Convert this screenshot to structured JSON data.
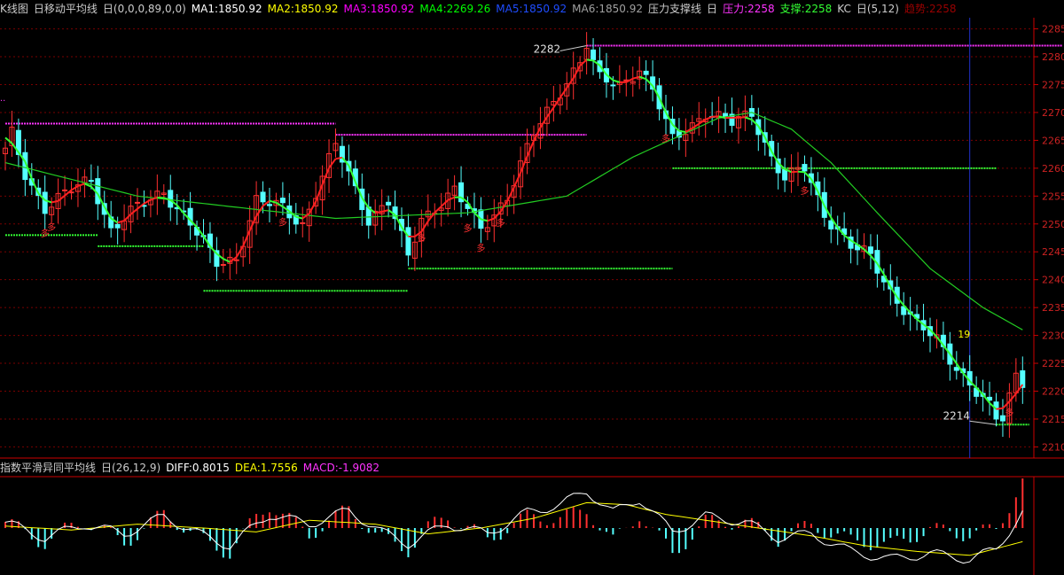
{
  "main_legend": [
    {
      "text": "K线图",
      "color": "#cccccc"
    },
    {
      "text": "日移动平均线",
      "color": "#cccccc"
    },
    {
      "text": "日(0,0,0,89,0,0)",
      "color": "#cccccc"
    },
    {
      "text": "MA1:1850.92",
      "color": "#ffffff"
    },
    {
      "text": "MA2:1850.92",
      "color": "#ffff00"
    },
    {
      "text": "MA3:1850.92",
      "color": "#ff00ff"
    },
    {
      "text": "MA4:2269.26",
      "color": "#00ff00"
    },
    {
      "text": "MA5:1850.92",
      "color": "#1f4dff"
    },
    {
      "text": "MA6:1850.92",
      "color": "#a0a0a0"
    },
    {
      "text": "压力支撑线",
      "color": "#cccccc"
    },
    {
      "text": "日",
      "color": "#cccccc"
    },
    {
      "text": "压力:2258",
      "color": "#ff33ff"
    },
    {
      "text": "支撑:2258",
      "color": "#33ff33"
    },
    {
      "text": "KC",
      "color": "#cccccc"
    },
    {
      "text": "日(5,12)",
      "color": "#cccccc"
    },
    {
      "text": "趋势:2258",
      "color": "#990000"
    }
  ],
  "macd_legend": [
    {
      "text": "指数平滑异同平均线",
      "color": "#cccccc"
    },
    {
      "text": "日(26,12,9)",
      "color": "#cccccc"
    },
    {
      "text": "DIFF:0.8015",
      "color": "#ffffff"
    },
    {
      "text": "DEA:1.7556",
      "color": "#ffff00"
    },
    {
      "text": "MACD:-1.9082",
      "color": "#ff33ff"
    }
  ],
  "colors": {
    "background": "#000000",
    "up": "#ff3030",
    "down": "#54ffff",
    "grid": "#7a0000",
    "axis": "#cc0000",
    "axis_text": "#cc2222",
    "resistance": "#ff33ff",
    "support": "#33ff33",
    "ma_long": "#22cc22",
    "trend_up": "#ff2020",
    "trend_down": "#33ff33",
    "cursor": "#2233cc",
    "diff": "#ffffff",
    "dea": "#ffff00"
  },
  "chart_data": {
    "type": "candlestick",
    "price_axis": {
      "ylim": [
        2208,
        2287
      ],
      "ticks": [
        2210,
        2215,
        2220,
        2225,
        2230,
        2235,
        2240,
        2245,
        2250,
        2255,
        2260,
        2265,
        2270,
        2275,
        2280,
        2285
      ]
    },
    "annotations": [
      {
        "text": "2282",
        "index": 88,
        "price": 2282
      },
      {
        "text": "2214",
        "index": 150,
        "price": 2214
      },
      {
        "text": "19",
        "index": 145,
        "price": 2229
      }
    ],
    "signal_label": "多",
    "cursor_index": 146,
    "resistance_lines": [
      {
        "start": 0,
        "end": 50,
        "price": 2268
      },
      {
        "start": 50,
        "end": 88,
        "price": 2266
      },
      {
        "start": 88,
        "end": 160,
        "price": 2282
      }
    ],
    "support_lines": [
      {
        "start": 0,
        "end": 14,
        "price": 2248
      },
      {
        "start": 14,
        "end": 30,
        "price": 2246
      },
      {
        "start": 30,
        "end": 61,
        "price": 2238
      },
      {
        "start": 61,
        "end": 101,
        "price": 2242
      },
      {
        "start": 101,
        "end": 150,
        "price": 2260
      },
      {
        "start": 150,
        "end": 155,
        "price": 2214
      }
    ],
    "price_anchors": [
      [
        0,
        2263
      ],
      [
        1,
        2266
      ],
      [
        3,
        2259
      ],
      [
        6,
        2253
      ],
      [
        10,
        2256
      ],
      [
        13,
        2258
      ],
      [
        16,
        2249
      ],
      [
        19,
        2252
      ],
      [
        24,
        2256
      ],
      [
        28,
        2250
      ],
      [
        32,
        2243
      ],
      [
        35,
        2244
      ],
      [
        38,
        2254
      ],
      [
        42,
        2253
      ],
      [
        45,
        2250
      ],
      [
        50,
        2264
      ],
      [
        52,
        2259
      ],
      [
        55,
        2251
      ],
      [
        58,
        2254
      ],
      [
        61,
        2244
      ],
      [
        63,
        2251
      ],
      [
        68,
        2256
      ],
      [
        72,
        2249
      ],
      [
        76,
        2255
      ],
      [
        80,
        2266
      ],
      [
        84,
        2274
      ],
      [
        88,
        2281
      ],
      [
        90,
        2276
      ],
      [
        93,
        2275
      ],
      [
        96,
        2278
      ],
      [
        98,
        2274
      ],
      [
        101,
        2265
      ],
      [
        103,
        2267
      ],
      [
        106,
        2270
      ],
      [
        110,
        2268
      ],
      [
        113,
        2270
      ],
      [
        116,
        2262
      ],
      [
        118,
        2258
      ],
      [
        121,
        2260
      ],
      [
        124,
        2252
      ],
      [
        128,
        2246
      ],
      [
        131,
        2244
      ],
      [
        134,
        2238
      ],
      [
        138,
        2232
      ],
      [
        141,
        2229
      ],
      [
        145,
        2223
      ],
      [
        149,
        2217
      ],
      [
        151,
        2215
      ],
      [
        153,
        2223
      ],
      [
        154,
        2222
      ]
    ],
    "ma_long_anchors": [
      [
        0,
        2261
      ],
      [
        20,
        2255
      ],
      [
        50,
        2251
      ],
      [
        70,
        2252
      ],
      [
        85,
        2255
      ],
      [
        95,
        2262
      ],
      [
        108,
        2269
      ],
      [
        113,
        2270
      ],
      [
        119,
        2267
      ],
      [
        125,
        2261
      ],
      [
        132,
        2252
      ],
      [
        140,
        2242
      ],
      [
        148,
        2235
      ],
      [
        154,
        2231
      ]
    ],
    "macd": {
      "diff_anchors": [
        [
          0,
          0.3
        ],
        [
          6,
          -0.5
        ],
        [
          12,
          0.2
        ],
        [
          18,
          -0.3
        ],
        [
          24,
          0.6
        ],
        [
          30,
          -0.4
        ],
        [
          34,
          -0.9
        ],
        [
          40,
          0.7
        ],
        [
          46,
          0.2
        ],
        [
          52,
          0.9
        ],
        [
          57,
          -0.2
        ],
        [
          61,
          -0.8
        ],
        [
          67,
          0.2
        ],
        [
          73,
          -0.3
        ],
        [
          79,
          0.8
        ],
        [
          84,
          1.2
        ],
        [
          88,
          1.9
        ],
        [
          92,
          0.8
        ],
        [
          96,
          1.5
        ],
        [
          101,
          -0.2
        ],
        [
          106,
          0.6
        ],
        [
          112,
          0.3
        ],
        [
          117,
          -0.5
        ],
        [
          122,
          -0.3
        ],
        [
          128,
          -1.2
        ],
        [
          134,
          -1.6
        ],
        [
          140,
          -1.3
        ],
        [
          146,
          -1.6
        ],
        [
          150,
          -1.1
        ],
        [
          154,
          0.8
        ]
      ],
      "dea_anchors": [
        [
          0,
          0.1
        ],
        [
          10,
          -0.1
        ],
        [
          20,
          0.2
        ],
        [
          30,
          0.0
        ],
        [
          38,
          -0.2
        ],
        [
          46,
          0.4
        ],
        [
          56,
          0.2
        ],
        [
          64,
          -0.3
        ],
        [
          72,
          0.0
        ],
        [
          80,
          0.5
        ],
        [
          88,
          1.3
        ],
        [
          94,
          1.2
        ],
        [
          100,
          0.7
        ],
        [
          106,
          0.4
        ],
        [
          114,
          0.0
        ],
        [
          122,
          -0.4
        ],
        [
          130,
          -0.9
        ],
        [
          138,
          -1.2
        ],
        [
          146,
          -1.4
        ],
        [
          154,
          -0.7
        ]
      ]
    }
  }
}
